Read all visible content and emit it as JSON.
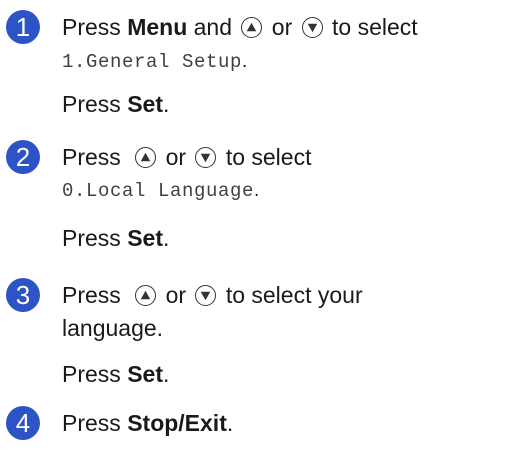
{
  "steps": [
    {
      "number": "1",
      "press": "Press",
      "menu": "Menu",
      "and": "and",
      "or": "or",
      "to_select": "to select",
      "setting": "1.General Setup",
      "period": ".",
      "press_set": "Press",
      "set": "Set",
      "set_period": "."
    },
    {
      "number": "2",
      "press": "Press",
      "or": "or",
      "to_select": "to select",
      "setting": "0.Local Language",
      "period": ".",
      "press_set": "Press",
      "set": "Set",
      "set_period": "."
    },
    {
      "number": "3",
      "press": "Press",
      "or": "or",
      "to_select": "to select your",
      "line2": "language.",
      "press_set": "Press",
      "set": "Set",
      "set_period": "."
    },
    {
      "number": "4",
      "press": "Press",
      "stop": "Stop/Exit",
      "period": "."
    }
  ],
  "icons": {
    "up": "up-arrow-key-icon",
    "down": "down-arrow-key-icon"
  },
  "colors": {
    "step_badge": "#2d54c6"
  }
}
